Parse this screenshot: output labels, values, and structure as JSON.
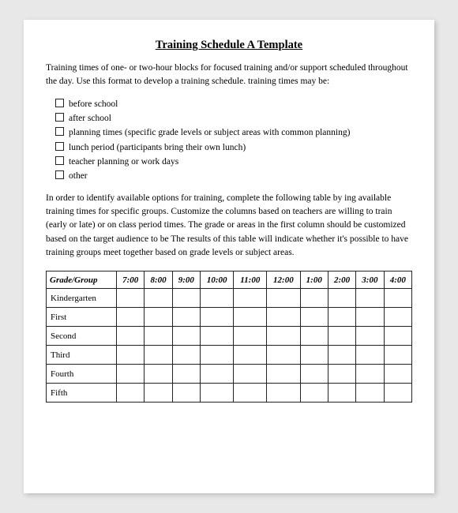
{
  "title": "Training Schedule A Template",
  "intro": {
    "paragraph1": "Training times of one- or two-hour blocks for focused training and/or support scheduled throughout the day. Use this format to develop a training schedule. training times may be:"
  },
  "checklist": [
    "before school",
    "after school",
    "planning times (specific grade levels or subject areas with common planning)",
    "lunch period (participants bring their own lunch)",
    "teacher planning or work days",
    "other"
  ],
  "body": "In order to identify available options for training, complete the following table by ing available training times for specific groups. Customize the columns based on teachers are willing to train (early or late) or on class period times. The grade or areas in the first column should be customized based on the target audience to be The results of this table will indicate whether it's possible to have training groups meet together based on grade levels or subject areas.",
  "table": {
    "headers": [
      "Grade/Group",
      "7:00",
      "8:00",
      "9:00",
      "10:00",
      "11:00",
      "12:00",
      "1:00",
      "2:00",
      "3:00",
      "4:00"
    ],
    "rows": [
      "Kindergarten",
      "First",
      "Second",
      "Third",
      "Fourth",
      "Fifth"
    ]
  }
}
